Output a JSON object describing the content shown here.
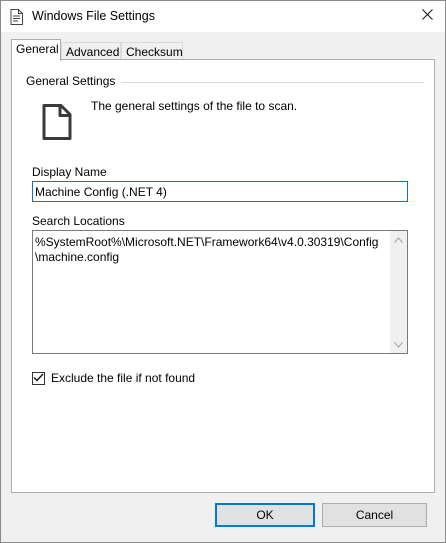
{
  "window": {
    "title": "Windows File Settings"
  },
  "tabs": [
    {
      "label": "General",
      "active": true
    },
    {
      "label": "Advanced",
      "active": false
    },
    {
      "label": "Checksum",
      "active": false
    }
  ],
  "general": {
    "section_title": "General Settings",
    "description": "The general settings of the file to scan.",
    "display_name_label": "Display Name",
    "display_name_value": "Machine Config (.NET 4)",
    "search_locations_label": "Search Locations",
    "search_locations_value": "%SystemRoot%\\Microsoft.NET\\Framework64\\v4.0.30319\\Config\n\\machine.config",
    "exclude_label": "Exclude the file if not found",
    "exclude_checked": true
  },
  "buttons": {
    "ok": "OK",
    "cancel": "Cancel"
  },
  "icons": {
    "title": "document-settings-icon",
    "close": "close-icon",
    "file": "file-icon",
    "check": "checkmark-icon",
    "scroll_up": "chevron-up-icon",
    "scroll_down": "chevron-down-icon"
  },
  "colors": {
    "accent": "#0078d7",
    "dialog_background": "#f0f0f0",
    "panel_background": "#ffffff"
  }
}
